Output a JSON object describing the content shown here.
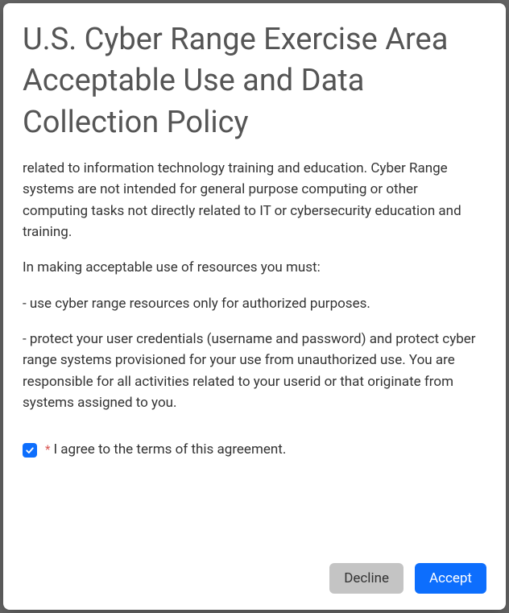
{
  "modal": {
    "title": "U.S. Cyber Range Exercise Area Acceptable Use and Data Collection Policy",
    "body": {
      "p1": "related to information technology training and education. Cyber Range systems are not intended for general purpose computing or other computing tasks not directly related to IT or cybersecurity education and training.",
      "p2": "In making acceptable use of resources you must:",
      "p3": "- use cyber range resources only for authorized purposes.",
      "p4": "- protect your user credentials (username and password) and protect cyber range systems provisioned for your use from unauthorized use. You are responsible for all activities related to your userid or that originate from systems assigned to you."
    },
    "agreement": {
      "required_marker": "*",
      "label": "I agree to the terms of this agreement.",
      "checked": true
    },
    "buttons": {
      "decline": "Decline",
      "accept": "Accept"
    }
  }
}
